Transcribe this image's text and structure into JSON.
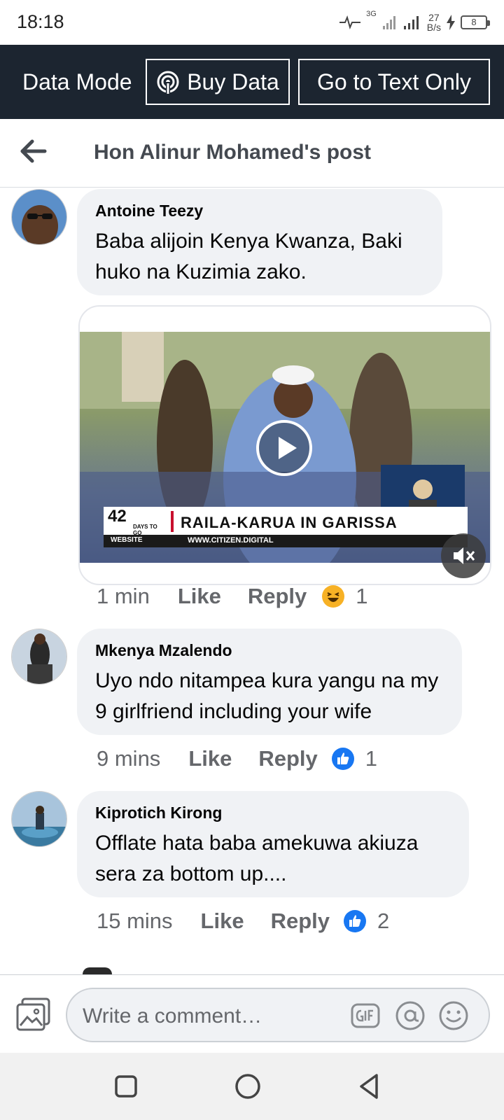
{
  "status_bar": {
    "time": "18:18",
    "network": "3G",
    "speed_value": "27",
    "speed_unit": "B/s",
    "battery": "8"
  },
  "data_bar": {
    "mode_label": "Data Mode",
    "buy_data_label": "Buy Data",
    "text_only_label": "Go to Text Only"
  },
  "header": {
    "title": "Hon Alinur Mohamed's post"
  },
  "comments": [
    {
      "author": "Antoine Teezy",
      "text": "Baba alijoin Kenya Kwanza, Baki huko na Kuzimia zako.",
      "time": "1 min",
      "like_label": "Like",
      "reply_label": "Reply",
      "reaction": "haha",
      "reaction_count": "1"
    },
    {
      "author": "Mkenya Mzalendo",
      "text": "Uyo ndo nitampea kura yangu na my 9 girlfriend including your wife",
      "time": "9 mins",
      "like_label": "Like",
      "reply_label": "Reply",
      "reaction": "like",
      "reaction_count": "1"
    },
    {
      "author": "Kiprotich Kirong",
      "text": "Offlate hata baba amekuwa akiuza sera za bottom up....",
      "time": "15 mins",
      "like_label": "Like",
      "reply_label": "Reply",
      "reaction": "like",
      "reaction_count": "2"
    }
  ],
  "video": {
    "days_number": "42",
    "days_label": "DAYS TO GO",
    "headline": "RAILA-KARUA IN GARISSA",
    "website_label": "WEBSITE",
    "website_url": "WWW.CITIZEN.DIGITAL"
  },
  "composer": {
    "placeholder": "Write a comment…",
    "icons": [
      "photo-icon",
      "gif-icon",
      "mention-icon",
      "emoji-icon"
    ]
  },
  "colors": {
    "data_bar_bg": "#1c2530",
    "bubble_bg": "#f0f2f5",
    "like_blue": "#1877f2",
    "meta_gray": "#65676b"
  }
}
